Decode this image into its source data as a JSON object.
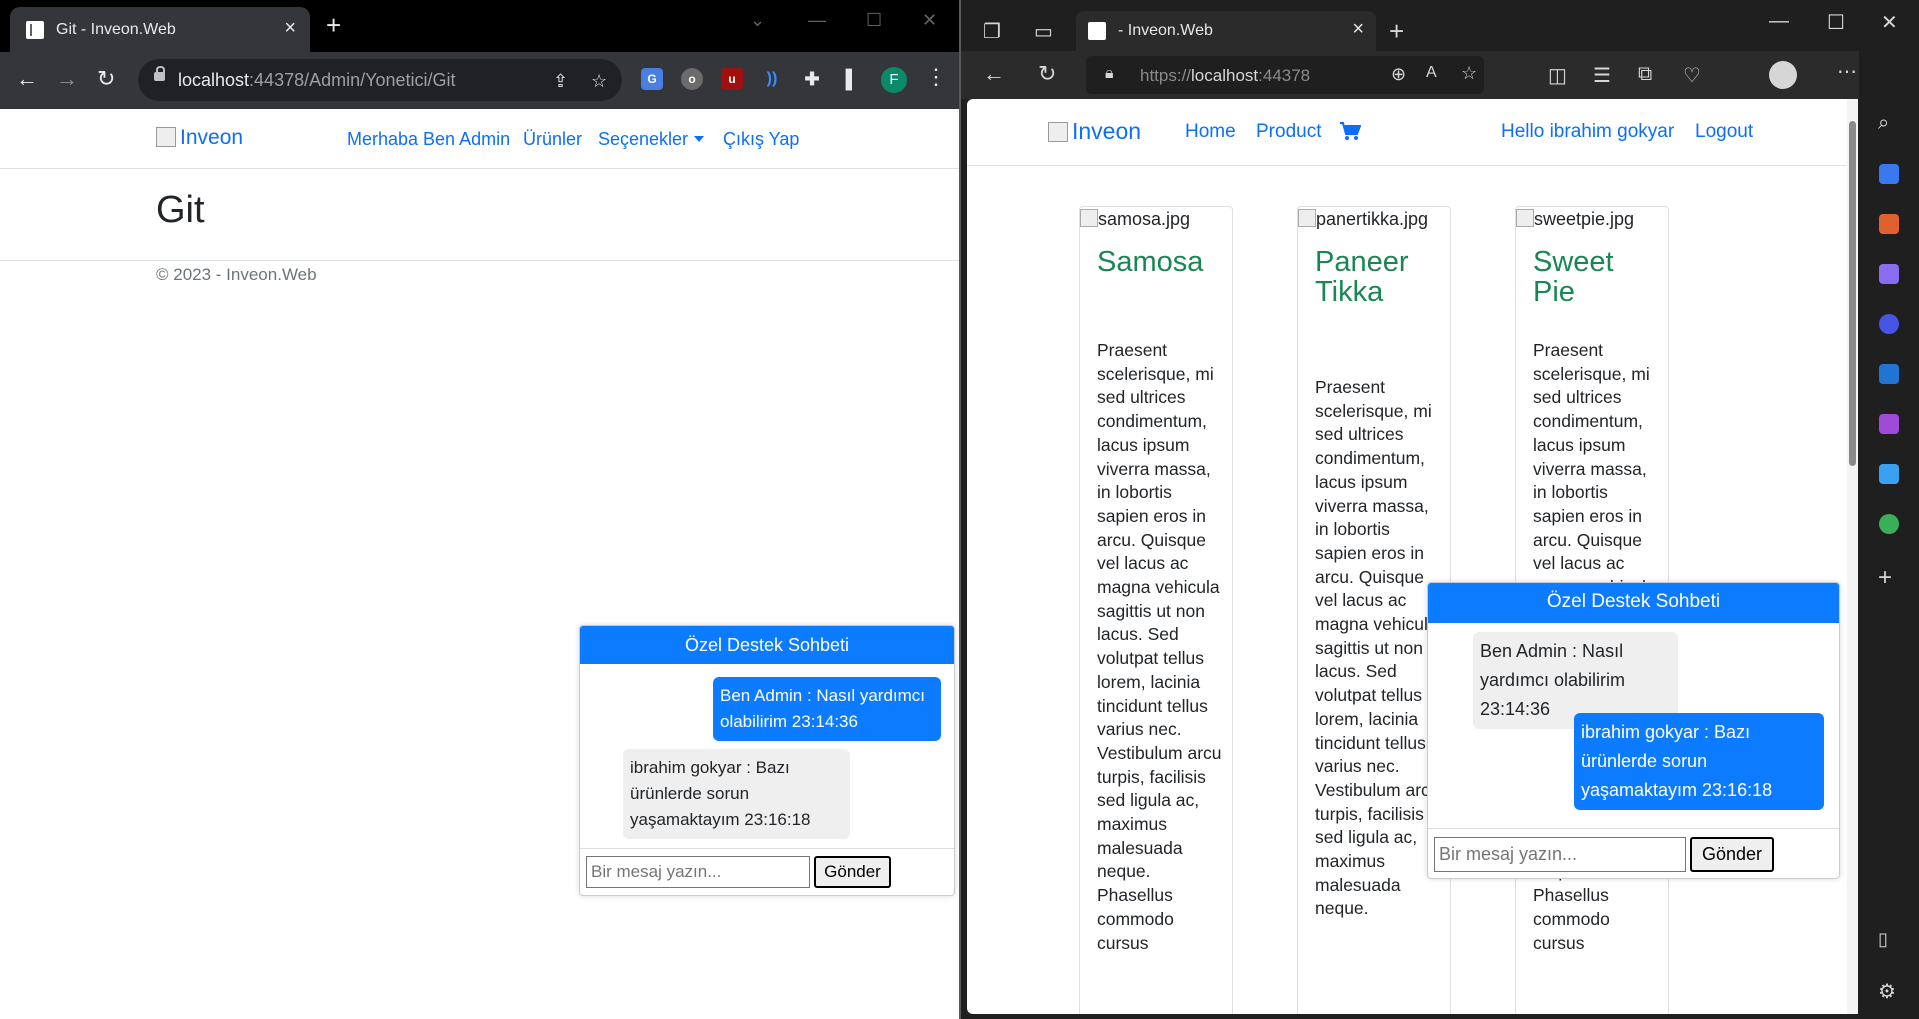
{
  "left_browser": {
    "tab_title": "Git - Inveon.Web",
    "url_host": "localhost",
    "url_rest": ":44378/Admin/Yonetici/Git",
    "profile_initial": "F",
    "site": {
      "brand": "Inveon",
      "nav": [
        "Merhaba Ben Admin",
        "Ürünler",
        "Seçenekler",
        "Çıkış Yap"
      ],
      "heading": "Git",
      "footer": "© 2023 - Inveon.Web"
    },
    "chat": {
      "title": "Özel Destek Sohbeti",
      "messages": [
        {
          "sender": "me",
          "text": "Ben Admin : Nasıl yardımcı olabilirim 23:14:36"
        },
        {
          "sender": "other",
          "text": "ibrahim gokyar : Bazı ürünlerde sorun yaşamaktayım 23:16:18"
        }
      ],
      "input_placeholder": "Bir mesaj yazın...",
      "send_label": "Gönder"
    }
  },
  "right_browser": {
    "tab_title": "- Inveon.Web",
    "url_scheme": "https://",
    "url_host": "localhost",
    "url_port": ":44378",
    "site": {
      "brand": "Inveon",
      "nav": [
        "Home",
        "Product"
      ],
      "user_greeting": "Hello ibrahim gokyar",
      "logout": "Logout"
    },
    "products": [
      {
        "img_alt": "samosa.jpg",
        "title": "Samosa",
        "description": "Praesent scelerisque, mi sed ultrices condimentum, lacus ipsum viverra massa, in lobortis sapien eros in arcu. Quisque vel lacus ac magna vehicula sagittis ut non lacus. Sed volutpat tellus lorem, lacinia tincidunt tellus varius nec. Vestibulum arcu turpis, facilisis sed ligula ac, maximus malesuada neque. Phasellus commodo cursus"
      },
      {
        "img_alt": "panertikka.jpg",
        "title": "Paneer Tikka",
        "description": "Praesent scelerisque, mi sed ultrices condimentum, lacus ipsum viverra massa, in lobortis sapien eros in arcu. Quisque vel lacus ac magna vehicula sagittis ut non lacus. Sed volutpat tellus lorem, lacinia tincidunt tellus varius nec. Vestibulum arcu turpis, facilisis sed ligula ac, maximus malesuada neque."
      },
      {
        "img_alt": "sweetpie.jpg",
        "title": "Sweet Pie",
        "description": "Praesent scelerisque, mi sed ultrices condimentum, lacus ipsum viverra massa, in lobortis sapien eros in arcu. Quisque vel lacus ac magna vehicula sagittis ut non lacus. Sed volutpat tellus lorem, lacinia tincidunt tellus varius nec. Vestibulum arcu turpis, facilisis sed ligula ac, maximus malesuada neque. Phasellus commodo cursus"
      }
    ],
    "chat": {
      "title": "Özel Destek Sohbeti",
      "messages": [
        {
          "sender": "other",
          "text": "Ben Admin : Nasıl yardımcı olabilirim 23:14:36"
        },
        {
          "sender": "me",
          "text": "ibrahim gokyar : Bazı ürünlerde sorun yaşamaktayım 23:16:18"
        }
      ],
      "input_placeholder": "Bir mesaj yazın...",
      "send_label": "Gönder"
    }
  },
  "colors": {
    "link": "#0d6efd",
    "chat_header": "#0d7bff",
    "product_title": "#198754"
  }
}
